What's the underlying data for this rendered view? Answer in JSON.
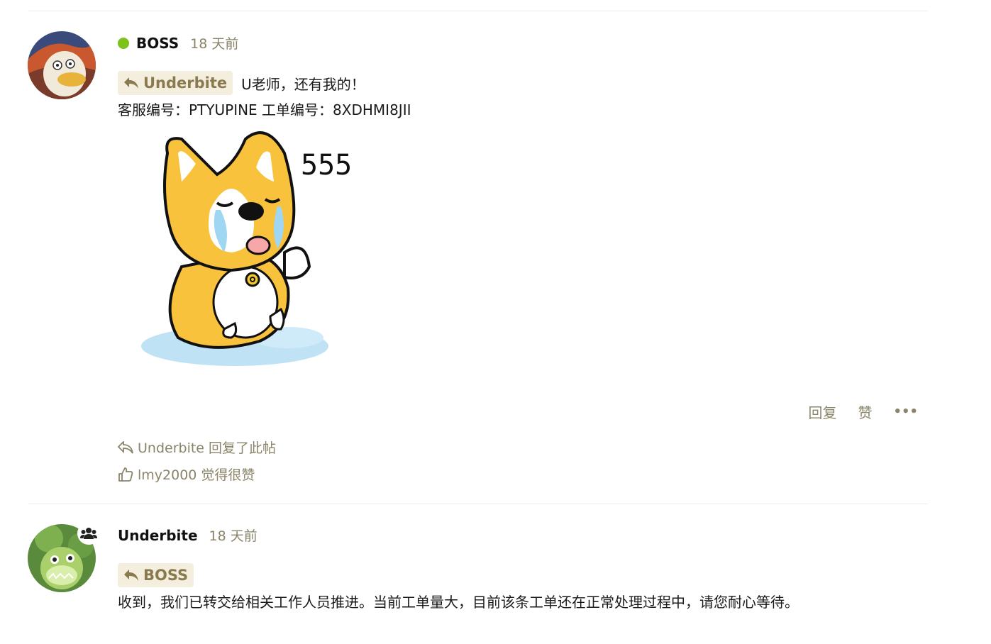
{
  "posts": [
    {
      "username": "BOSS",
      "status_color": "#7cc21b",
      "time": "18 天前",
      "reply_to": "Underbite",
      "text_line1": "U老师，还有我的！",
      "text_line2": "客服编号：PTYUPINE 工单编号：8XDHMI8JII",
      "sticker_text": "555",
      "actions": {
        "reply": "回复",
        "like": "赞",
        "more": "•••"
      },
      "summary": [
        {
          "icon": "reply-arrow-icon",
          "text": "Underbite 回复了此帖"
        },
        {
          "icon": "thumbs-up-icon",
          "text": "lmy2000 觉得很赞"
        }
      ]
    },
    {
      "username": "Underbite",
      "time": "18 天前",
      "reply_to": "BOSS",
      "badge_icon": "group-icon",
      "text_line1": "收到，我们已转交给相关工作人员推进。当前工单量大，目前该条工单还在正常处理过程中，请您耐心等待。"
    }
  ],
  "colors": {
    "accent": "#8a8469",
    "chip_bg": "#f3eedd",
    "online": "#7cc21b"
  }
}
